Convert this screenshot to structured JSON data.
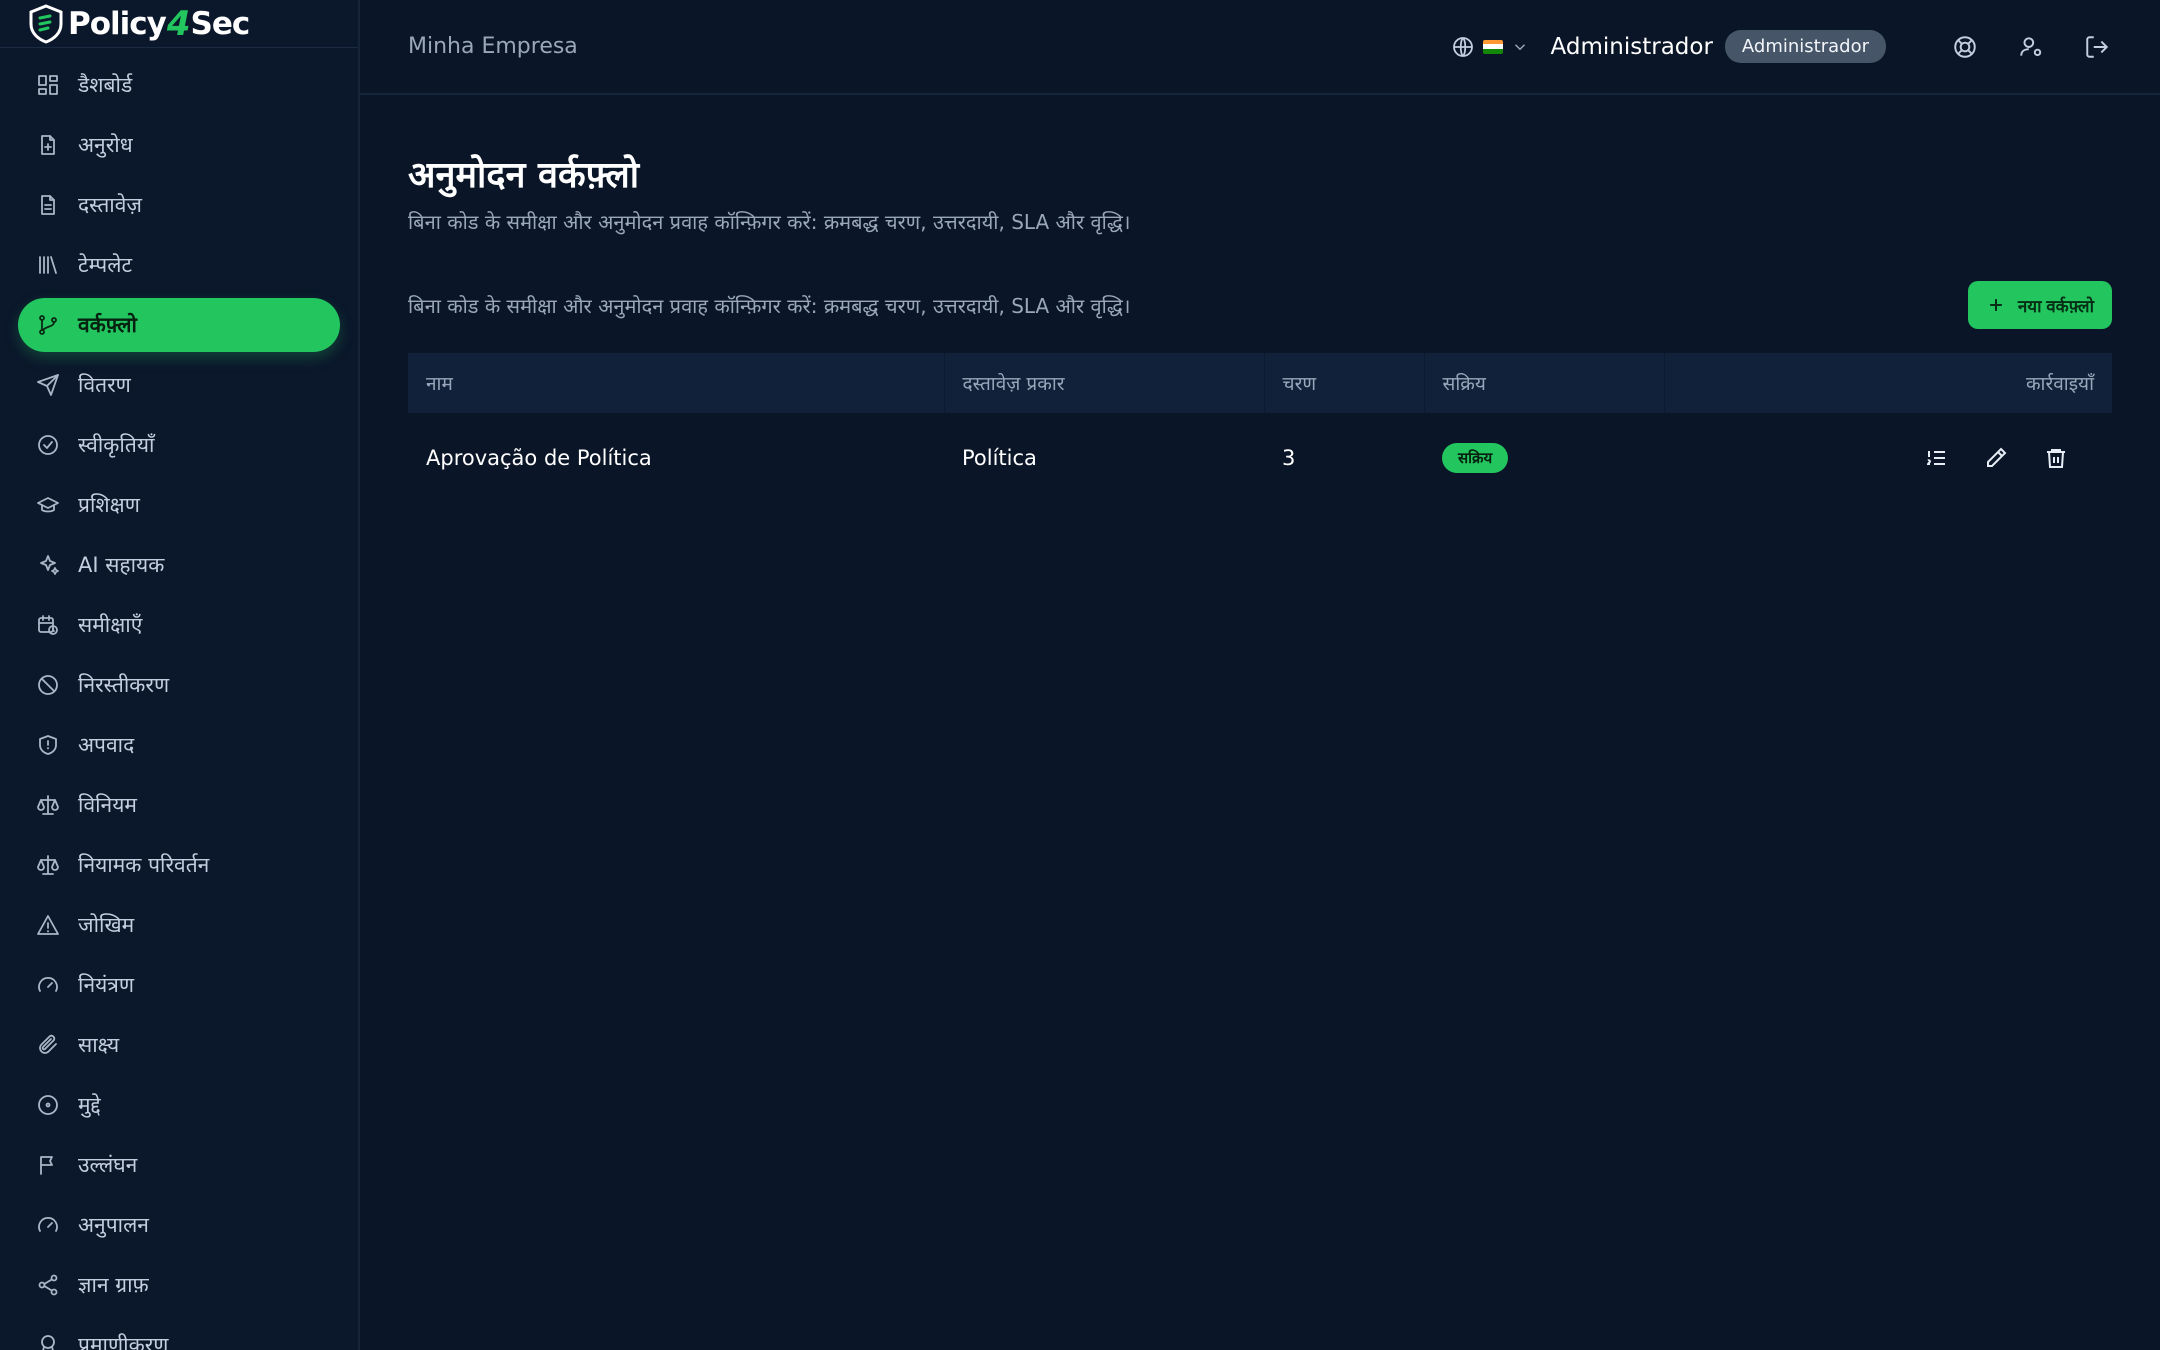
{
  "brand": {
    "name_prefix": "Policy",
    "name_four": "4",
    "name_suffix": "Sec"
  },
  "sidebar": {
    "items": [
      {
        "label": "डैशबोर्ड",
        "icon": "dashboard-icon"
      },
      {
        "label": "अनुरोध",
        "icon": "file-plus-icon"
      },
      {
        "label": "दस्तावेज़",
        "icon": "document-icon"
      },
      {
        "label": "टेम्पलेट",
        "icon": "library-icon"
      },
      {
        "label": "वर्कफ़्लो",
        "icon": "git-branch-icon",
        "active": true
      },
      {
        "label": "वितरण",
        "icon": "send-icon"
      },
      {
        "label": "स्वीकृतियाँ",
        "icon": "check-circle-icon"
      },
      {
        "label": "प्रशिक्षण",
        "icon": "graduation-cap-icon"
      },
      {
        "label": "AI सहायक",
        "icon": "sparkles-icon"
      },
      {
        "label": "समीक्षाएँ",
        "icon": "calendar-clock-icon"
      },
      {
        "label": "निरस्तीकरण",
        "icon": "ban-icon"
      },
      {
        "label": "अपवाद",
        "icon": "shield-alert-icon"
      },
      {
        "label": "विनियम",
        "icon": "scale-icon"
      },
      {
        "label": "नियामक परिवर्तन",
        "icon": "scale-icon"
      },
      {
        "label": "जोखिम",
        "icon": "alert-triangle-icon"
      },
      {
        "label": "नियंत्रण",
        "icon": "gauge-icon"
      },
      {
        "label": "साक्ष्य",
        "icon": "paperclip-icon"
      },
      {
        "label": "मुद्दे",
        "icon": "circle-dot-icon"
      },
      {
        "label": "उल्लंघन",
        "icon": "flag-icon"
      },
      {
        "label": "अनुपालन",
        "icon": "gauge-icon"
      },
      {
        "label": "ज्ञान ग्राफ़",
        "icon": "share-icon"
      },
      {
        "label": "प्रमाणीकरण",
        "icon": "badge-icon"
      }
    ]
  },
  "header": {
    "company": "Minha Empresa",
    "user_name": "Administrador",
    "role_badge": "Administrador"
  },
  "page": {
    "title": "अनुमोदन वर्कफ़्लो",
    "subtitle": "बिना कोड के समीक्षा और अनुमोदन प्रवाह कॉन्फ़िगर करें: क्रमबद्ध चरण, उत्तरदायी, SLA और वृद्धि।",
    "toolbar_desc": "बिना कोड के समीक्षा और अनुमोदन प्रवाह कॉन्फ़िगर करें: क्रमबद्ध चरण, उत्तरदायी, SLA और वृद्धि।",
    "new_button": "नया वर्कफ़्लो"
  },
  "table": {
    "columns": [
      "नाम",
      "दस्तावेज़ प्रकार",
      "चरण",
      "सक्रिय",
      "कार्रवाइयाँ"
    ],
    "rows": [
      {
        "name": "Aprovação de Política",
        "doc_type": "Política",
        "steps": "3",
        "status": "सक्रिय"
      }
    ]
  },
  "colors": {
    "accent": "#22c55e",
    "background": "#0a1628",
    "sidebar": "#0b172b"
  }
}
